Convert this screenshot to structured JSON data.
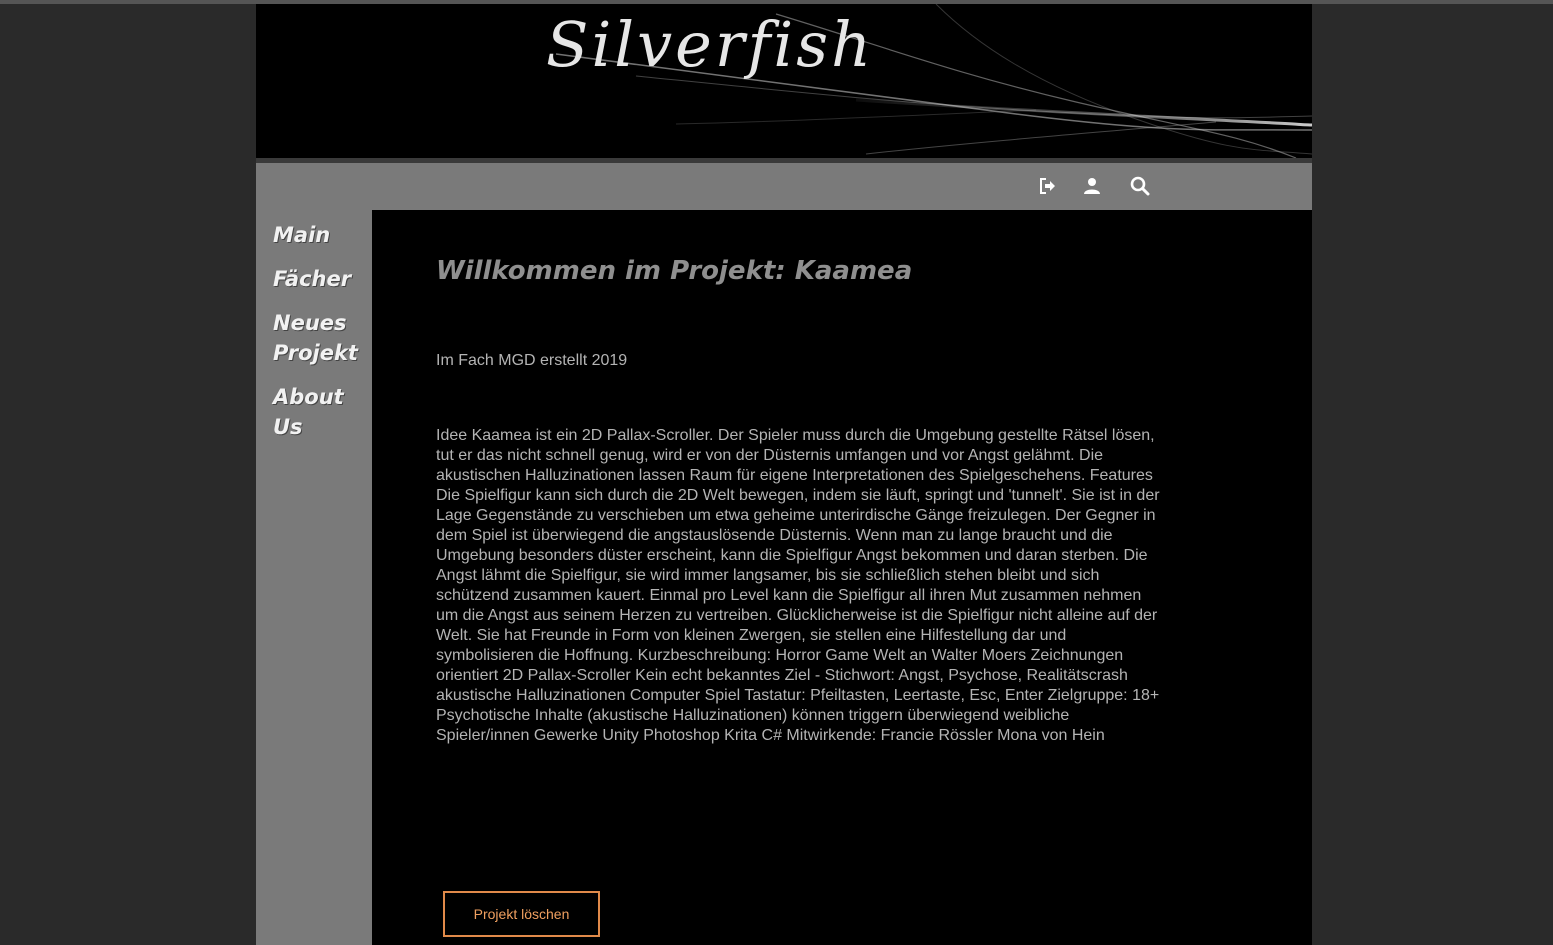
{
  "header": {
    "site_title": "Silverfish"
  },
  "toolbar": {
    "icons": [
      "sign-out-icon",
      "user-icon",
      "search-icon"
    ]
  },
  "sidebar": {
    "items": [
      {
        "label": "Main"
      },
      {
        "label": "Fächer"
      },
      {
        "label": "Neues Projekt"
      },
      {
        "label": "About Us"
      }
    ]
  },
  "main": {
    "heading": "Willkommen im Projekt: Kaamea",
    "subject_line": "Im Fach MGD erstellt 2019",
    "description": "Idee Kaamea ist ein 2D Pallax-Scroller. Der Spieler muss durch die Umgebung gestellte Rätsel lösen, tut er das nicht schnell genug, wird er von der Düsternis umfangen und vor Angst gelähmt. Die akustischen Halluzinationen lassen Raum für eigene Interpretationen des Spielgeschehens. Features Die Spielfigur kann sich durch die 2D Welt bewegen, indem sie läuft, springt und 'tunnelt'. Sie ist in der Lage Gegenstände zu verschieben um etwa geheime unterirdische Gänge freizulegen. Der Gegner in dem Spiel ist überwiegend die angstauslösende Düsternis. Wenn man zu lange braucht und die Umgebung besonders düster erscheint, kann die Spielfigur Angst bekommen und daran sterben. Die Angst lähmt die Spielfigur, sie wird immer langsamer, bis sie schließlich stehen bleibt und sich schützend zusammen kauert. Einmal pro Level kann die Spielfigur all ihren Mut zusammen nehmen um die Angst aus seinem Herzen zu vertreiben. Glücklicherweise ist die Spielfigur nicht alleine auf der Welt. Sie hat Freunde in Form von kleinen Zwergen, sie stellen eine Hilfestellung dar und symbolisieren die Hoffnung. Kurzbeschreibung: Horror Game Welt an Walter Moers Zeichnungen orientiert 2D Pallax-Scroller Kein echt bekanntes Ziel - Stichwort: Angst, Psychose, Realitätscrash akustische Halluzinationen Computer Spiel Tastatur: Pfeiltasten, Leertaste, Esc, Enter Zielgruppe: 18+ Psychotische Inhalte (akustische Halluzinationen) können triggern überwiegend weibliche Spieler/innen Gewerke Unity Photoshop Krita C# Mitwirkende: Francie Rössler Mona von Hein",
    "delete_button_label": "Projekt löschen"
  },
  "colors": {
    "page_bg": "#2a2a2a",
    "sidebar_bg": "#7a7a7a",
    "content_bg": "#000000",
    "heading": "#8f8f8f",
    "text": "#b4b4b4",
    "button_accent": "#e08a4a"
  }
}
